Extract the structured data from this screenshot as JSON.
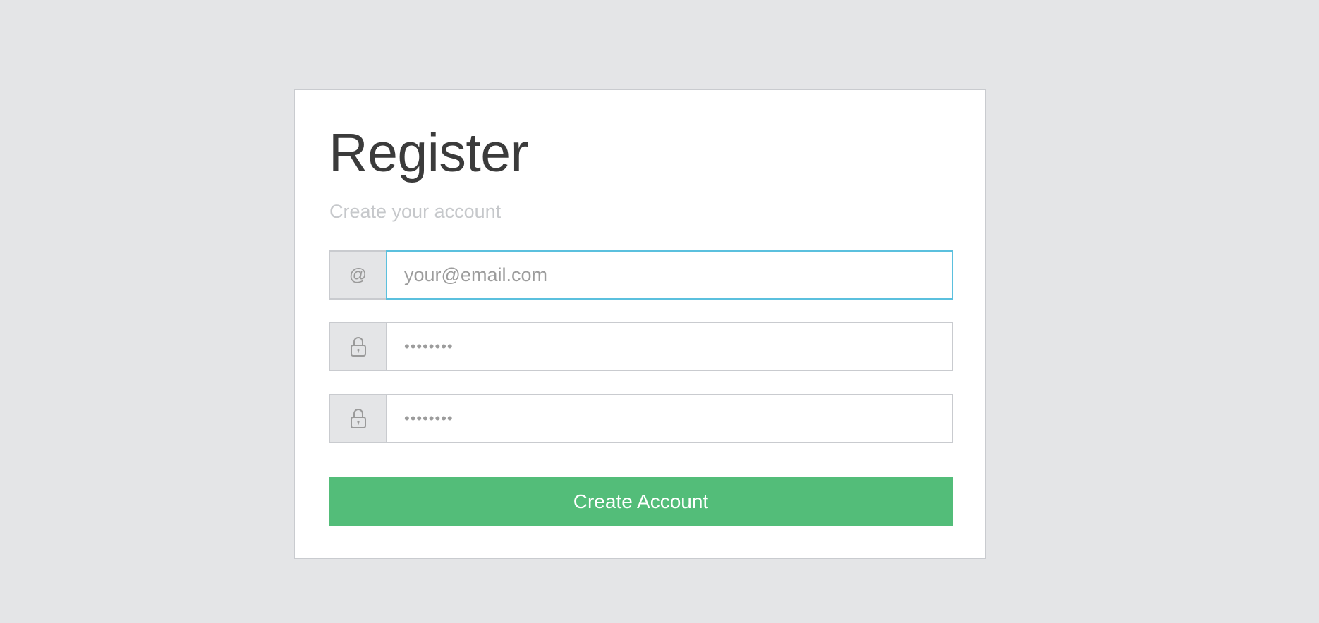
{
  "register": {
    "title": "Register",
    "subtitle": "Create your account",
    "email": {
      "addon_text": "@",
      "icon": "at-sign-icon",
      "placeholder": "your@email.com",
      "value": ""
    },
    "password": {
      "icon": "lock-icon",
      "placeholder": "••••••••",
      "value": ""
    },
    "confirm_password": {
      "icon": "lock-icon",
      "placeholder": "••••••••",
      "value": ""
    },
    "submit_label": "Create Account"
  },
  "colors": {
    "page_background": "#e4e5e7",
    "card_background": "#ffffff",
    "button": "#53bd79",
    "focus_border": "#5bc0de"
  }
}
